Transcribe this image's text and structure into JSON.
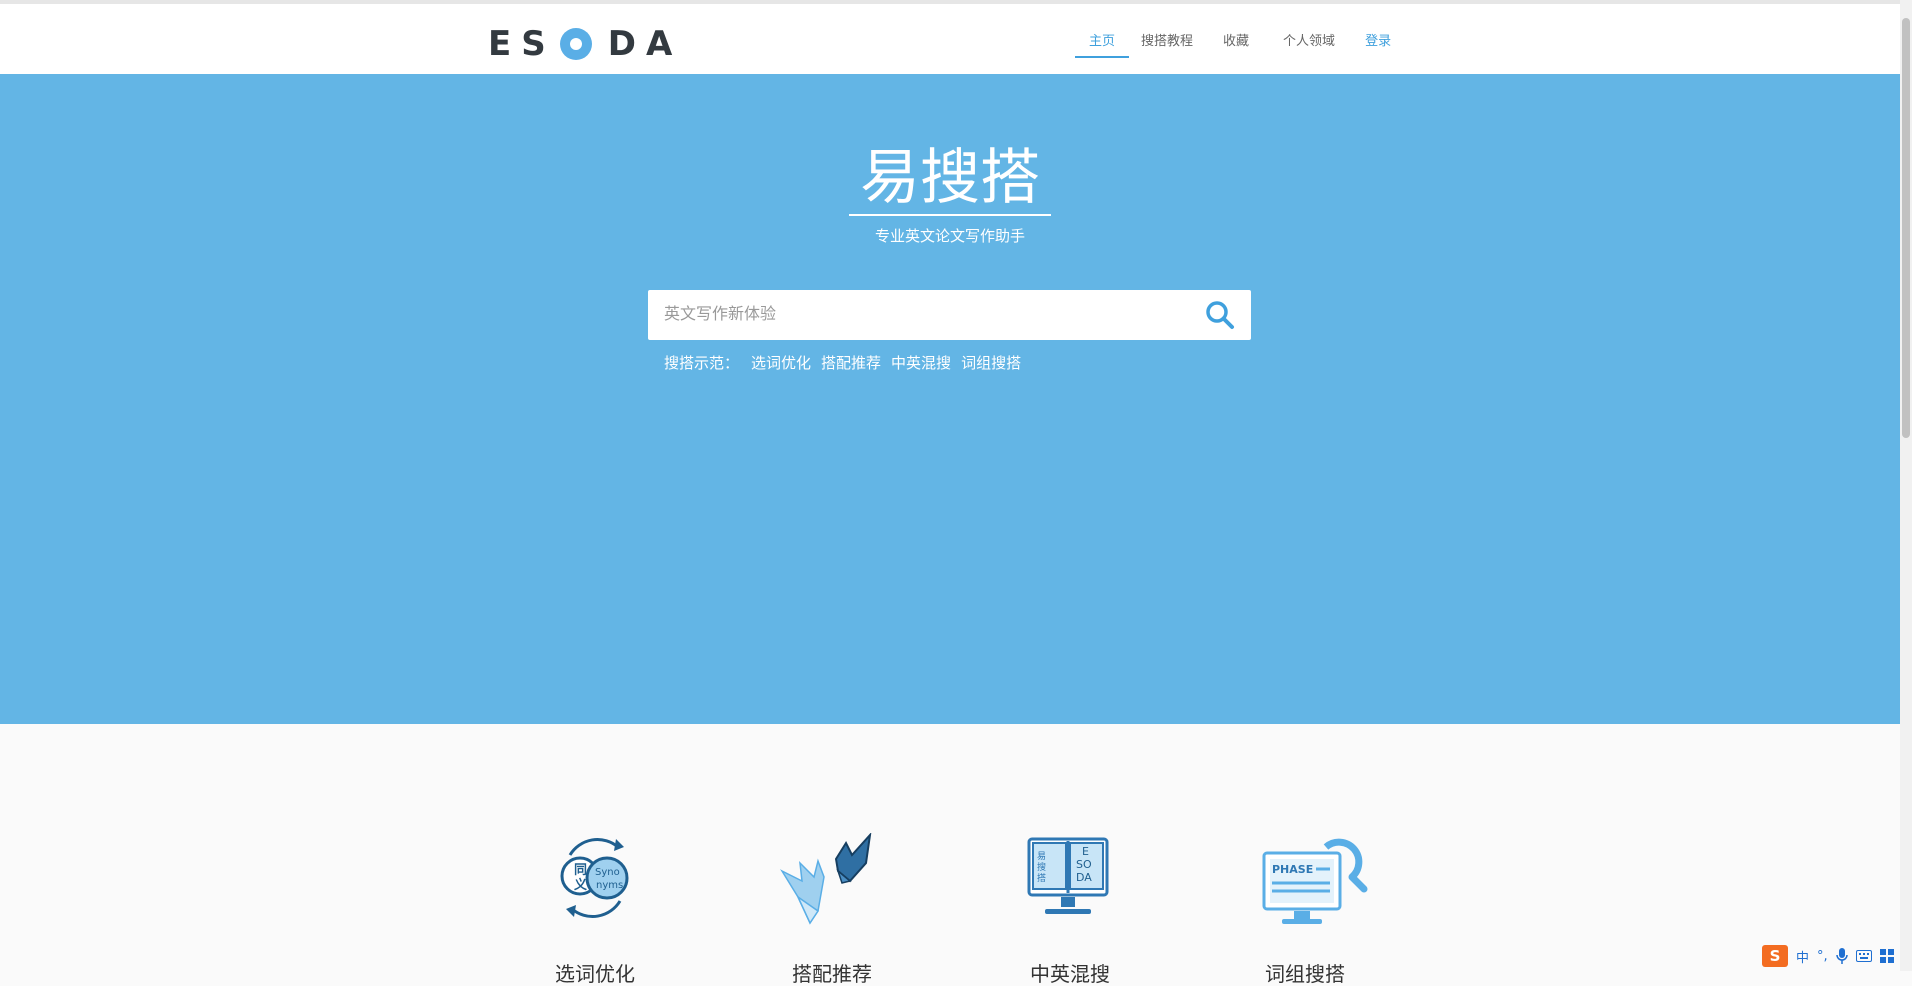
{
  "header": {
    "logo_text": "ESODA",
    "nav": [
      "主页",
      "搜搭教程",
      "收藏",
      "个人领域",
      "登录"
    ],
    "active_nav": "主页"
  },
  "hero": {
    "title": "易搜搭",
    "subtitle": "专业英文论文写作助手",
    "search_placeholder": "英文写作新体验",
    "examples_label": "搜搭示范：",
    "examples": [
      "选词优化",
      "搭配推荐",
      "中英混搜",
      "词组搜搭"
    ]
  },
  "features": [
    {
      "icon": "synonyms-icon",
      "label": "选词优化",
      "icon_text_a": "同",
      "icon_text_b": "义",
      "icon_text_c": "Syno",
      "icon_text_d": "nyms"
    },
    {
      "icon": "origami-birds-icon",
      "label": "搭配推荐"
    },
    {
      "icon": "book-monitor-icon",
      "label": "中英混搜",
      "icon_text_a": "易",
      "icon_text_b": "搜",
      "icon_text_c": "搭",
      "icon_text_d": "E",
      "icon_text_e": "SO",
      "icon_text_f": "DA"
    },
    {
      "icon": "phrase-search-icon",
      "label": "词组搜搭",
      "icon_text_a": "PHASE"
    }
  ],
  "ime": {
    "logo": "S",
    "mode": "中",
    "punct": "°,",
    "icons": [
      "microphone-icon",
      "keyboard-icon",
      "grid-icon"
    ]
  },
  "colors": {
    "hero_bg": "#63b5e5",
    "accent": "#3fa0dd",
    "icon_dark": "#1f5f8f",
    "icon_light": "#5aaee6"
  }
}
